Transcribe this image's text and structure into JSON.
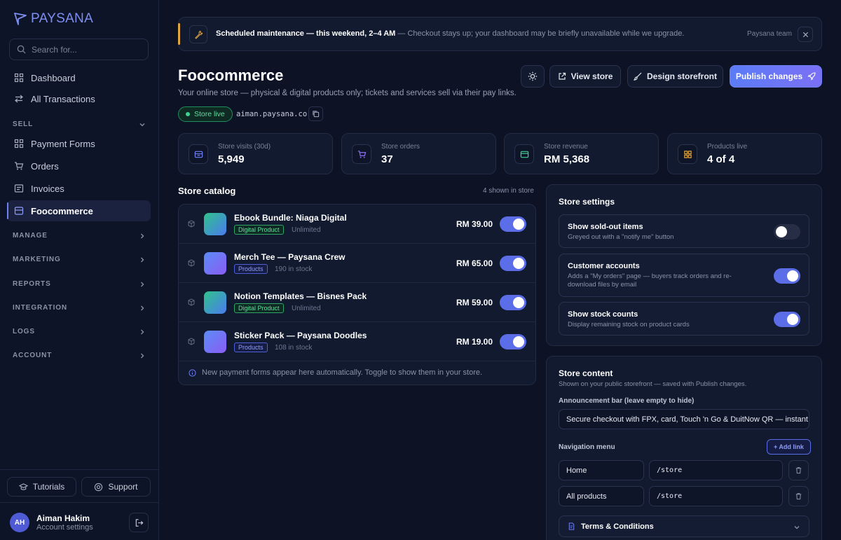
{
  "brand": {
    "name": "PAYSANA"
  },
  "sidebar": {
    "search_placeholder": "Search for...",
    "top_items": [
      {
        "label": "Dashboard",
        "icon": "grid-icon"
      },
      {
        "label": "All Transactions",
        "icon": "arrows-icon"
      }
    ],
    "sell": {
      "label": "SELL",
      "items": [
        {
          "label": "Payment Forms"
        },
        {
          "label": "Orders"
        },
        {
          "label": "Invoices"
        },
        {
          "label": "Foocommerce",
          "active": true
        }
      ]
    },
    "sections": [
      "MANAGE",
      "MARKETING",
      "REPORTS",
      "INTEGRATION",
      "LOGS",
      "ACCOUNT"
    ],
    "tutorials_label": "Tutorials",
    "support_label": "Support",
    "user": {
      "initials": "AH",
      "name": "Aiman Hakim",
      "sub": "Account settings"
    }
  },
  "banner": {
    "title": "Scheduled maintenance — this weekend, 2–4 AM",
    "text": "— Checkout stays up; your dashboard may be briefly unavailable while we upgrade.",
    "team": "Paysana team"
  },
  "header": {
    "title": "Foocommerce",
    "subtitle": "Your online store — physical & digital products only; tickets and services sell via their pay links.",
    "status": "Store live",
    "domain": "aiman.paysana.co",
    "view_store": "View store",
    "design": "Design storefront",
    "publish": "Publish changes"
  },
  "stats": [
    {
      "label": "Store visits (30d)",
      "value": "5,949",
      "icon": "store-icon",
      "color": "#6f7ff5"
    },
    {
      "label": "Store orders",
      "value": "37",
      "icon": "cart-icon",
      "color": "#8b6ff5"
    },
    {
      "label": "Store revenue",
      "value": "RM 5,368",
      "icon": "wallet-icon",
      "color": "#3ed190"
    },
    {
      "label": "Products live",
      "value": "4 of 4",
      "icon": "boxes-icon",
      "color": "#e0a640"
    }
  ],
  "catalog": {
    "title": "Store catalog",
    "count": "4 shown in store",
    "footer": "New payment forms appear here automatically. Toggle to show them in your store.",
    "products": [
      {
        "name": "Ebook Bundle: Niaga Digital",
        "tag": "Digital Product",
        "stock": "Unlimited",
        "price": "RM 39.00",
        "enabled": true
      },
      {
        "name": "Merch Tee — Paysana Crew",
        "tag": "Products",
        "stock": "190 in stock",
        "price": "RM 65.00",
        "enabled": true
      },
      {
        "name": "Notion Templates — Bisnes Pack",
        "tag": "Digital Product",
        "stock": "Unlimited",
        "price": "RM 59.00",
        "enabled": true
      },
      {
        "name": "Sticker Pack — Paysana Doodles",
        "tag": "Products",
        "stock": "108 in stock",
        "price": "RM 19.00",
        "enabled": true
      }
    ]
  },
  "settings": {
    "title": "Store settings",
    "rows": [
      {
        "title": "Show sold-out items",
        "desc": "Greyed out with a \"notify me\" button",
        "on": false
      },
      {
        "title": "Customer accounts",
        "desc": "Adds a \"My orders\" page — buyers track orders and re-download files by email",
        "on": true
      },
      {
        "title": "Show stock counts",
        "desc": "Display remaining stock on product cards",
        "on": true
      }
    ]
  },
  "content": {
    "title": "Store content",
    "subtitle": "Shown on your public storefront — saved with Publish changes.",
    "announcement_label": "Announcement bar (leave empty to hide)",
    "announcement_value": "Secure checkout with FPX, card, Touch 'n Go & DuitNow QR — instant",
    "nav_label": "Navigation menu",
    "add_link": "+ Add link",
    "nav": [
      {
        "label": "Home",
        "path": "/store"
      },
      {
        "label": "All products",
        "path": "/store"
      }
    ],
    "terms": "Terms & Conditions"
  }
}
